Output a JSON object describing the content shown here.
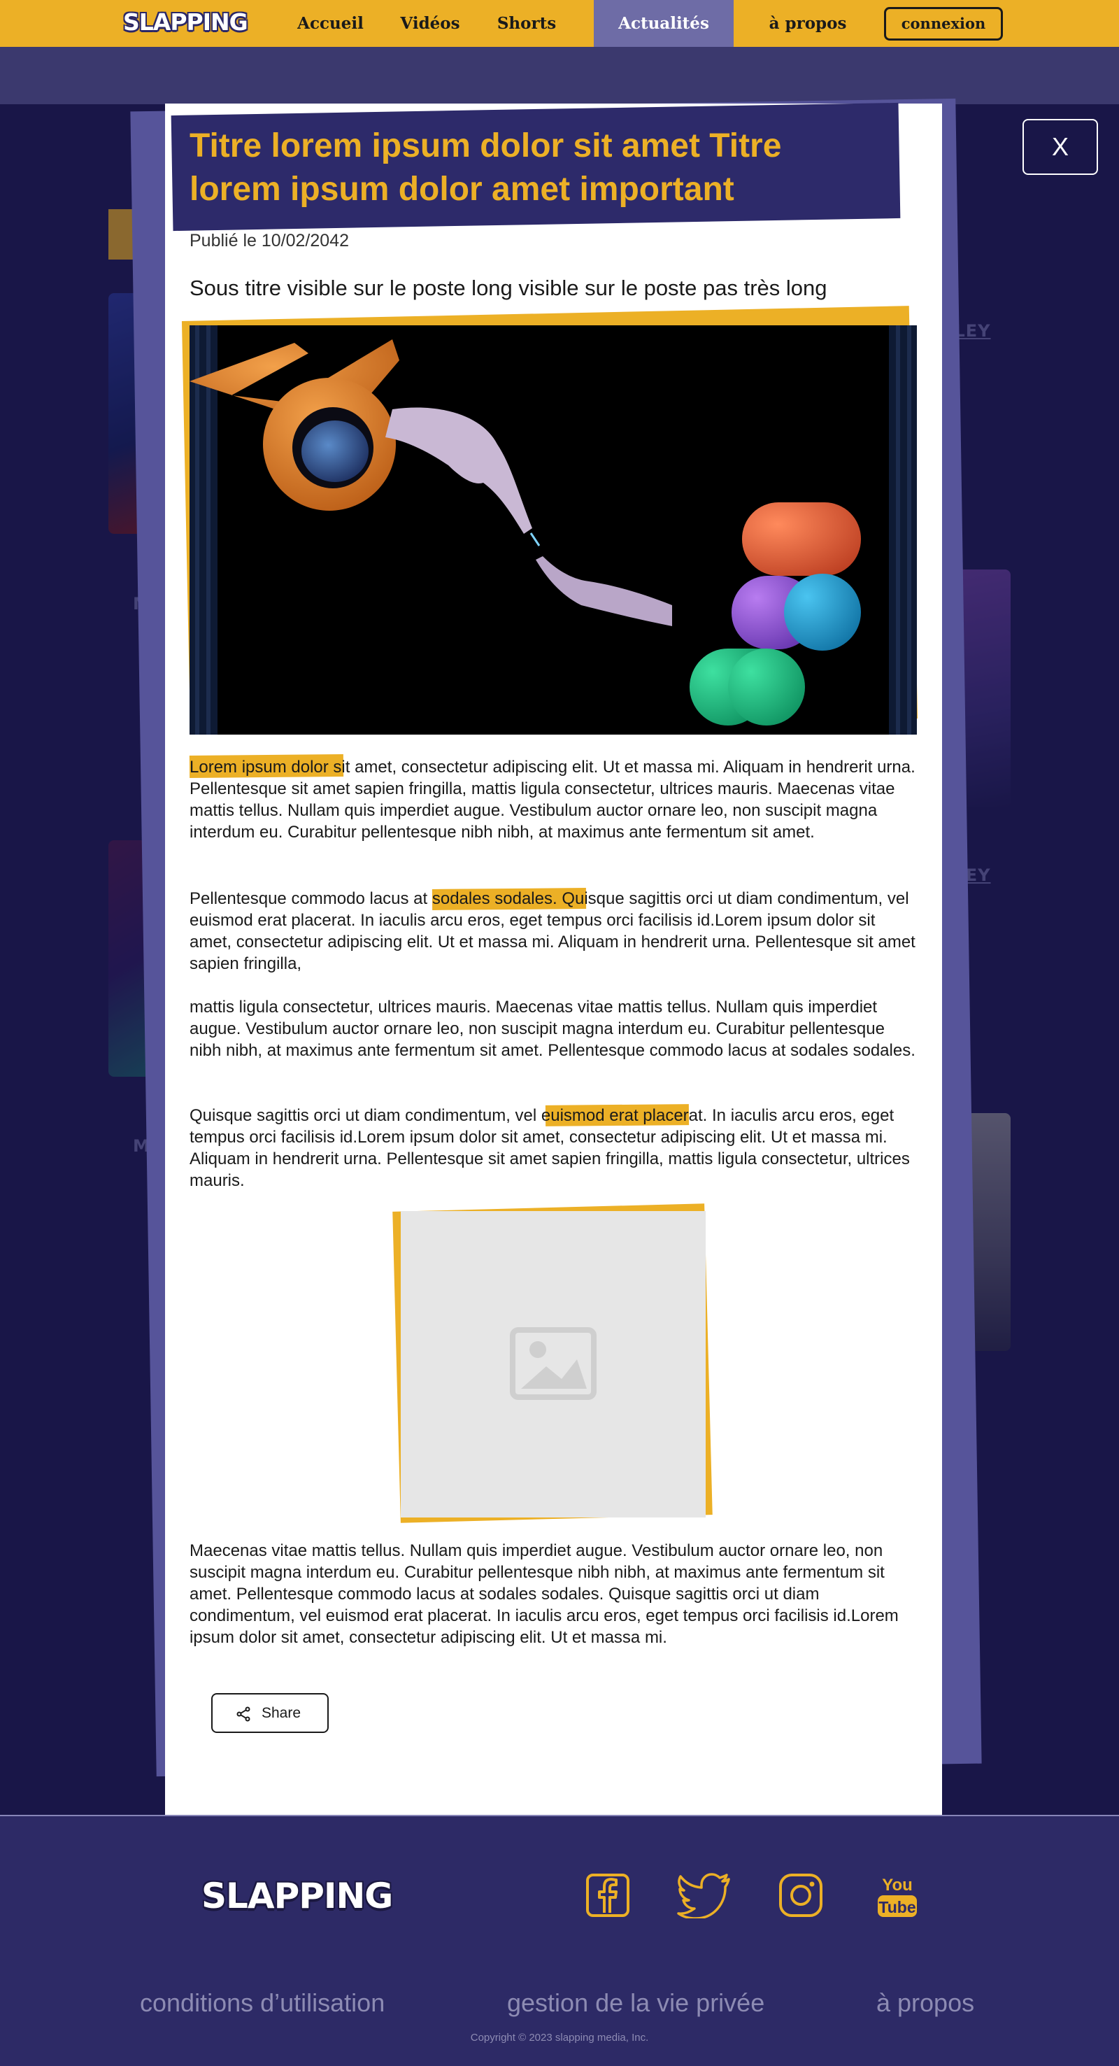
{
  "nav": {
    "logo": "SLAPPING",
    "links": [
      "Accueil",
      "Vidéos",
      "Shorts",
      "Actualités",
      "à propos"
    ],
    "active": "Actualités",
    "login": "connexion"
  },
  "background": {
    "card_labels": [
      "M",
      "MA"
    ],
    "side_labels": [
      "RLEY",
      "RLEY"
    ]
  },
  "article": {
    "title": "Titre lorem ipsum dolor sit amet Titre lorem ipsum dolor amet important",
    "published": "Publié le 10/02/2042",
    "subtitle": "Sous titre visible sur le poste long visible sur le poste pas très long",
    "paragraphs": [
      "Lorem ipsum dolor sit amet, consectetur adipiscing elit. Ut et massa mi. Aliquam in hendrerit urna. Pellentesque sit amet sapien fringilla, mattis ligula consectetur, ultrices mauris. Maecenas vitae mattis tellus. Nullam quis imperdiet augue. Vestibulum auctor ornare leo, non suscipit magna interdum eu. Curabitur pellentesque nibh nibh, at maximus ante fermentum sit amet.",
      "Pellentesque commodo lacus at sodales sodales. Quisque sagittis orci ut diam condimentum, vel euismod erat placerat. In iaculis arcu eros, eget tempus orci facilisis id.Lorem ipsum dolor sit amet, consectetur adipiscing elit. Ut et massa mi. Aliquam in hendrerit urna. Pellentesque sit amet sapien fringilla,",
      "mattis ligula consectetur, ultrices mauris. Maecenas vitae mattis tellus. Nullam quis imperdiet augue. Vestibulum auctor ornare leo, non suscipit magna interdum eu. Curabitur pellentesque nibh nibh, at maximus ante fermentum sit amet. Pellentesque commodo lacus at sodales sodales.",
      "Quisque sagittis orci ut diam condimentum, vel euismod erat placerat. In iaculis arcu eros, eget tempus orci facilisis id.Lorem ipsum dolor sit amet, consectetur adipiscing elit. Ut et massa mi. Aliquam in hendrerit urna. Pellentesque sit amet sapien fringilla, mattis ligula consectetur, ultrices mauris.",
      "Maecenas vitae mattis tellus. Nullam quis imperdiet augue. Vestibulum auctor ornare leo, non suscipit magna interdum eu. Curabitur pellentesque nibh nibh, at maximus ante fermentum sit amet. Pellentesque commodo lacus at sodales sodales. Quisque sagittis orci ut diam condimentum, vel euismod erat placerat. In iaculis arcu eros, eget tempus orci facilisis id.Lorem ipsum dolor sit amet, consectetur adipiscing elit. Ut et massa mi."
    ],
    "share_label": "Share",
    "close_label": "X"
  },
  "footer": {
    "logo": "SLAPPING",
    "social_icons": [
      "facebook-icon",
      "twitter-icon",
      "instagram-icon",
      "youtube-icon"
    ],
    "youtube_text": [
      "You",
      "Tube"
    ],
    "links": [
      "conditions d’utilisation",
      "gestion de la vie privée",
      "à propos"
    ],
    "copyright": "Copyright © 2023 slapping media, Inc."
  },
  "colors": {
    "accent": "#ecb026",
    "navy": "#1e1b52",
    "title_bg": "#2d2a6a"
  }
}
